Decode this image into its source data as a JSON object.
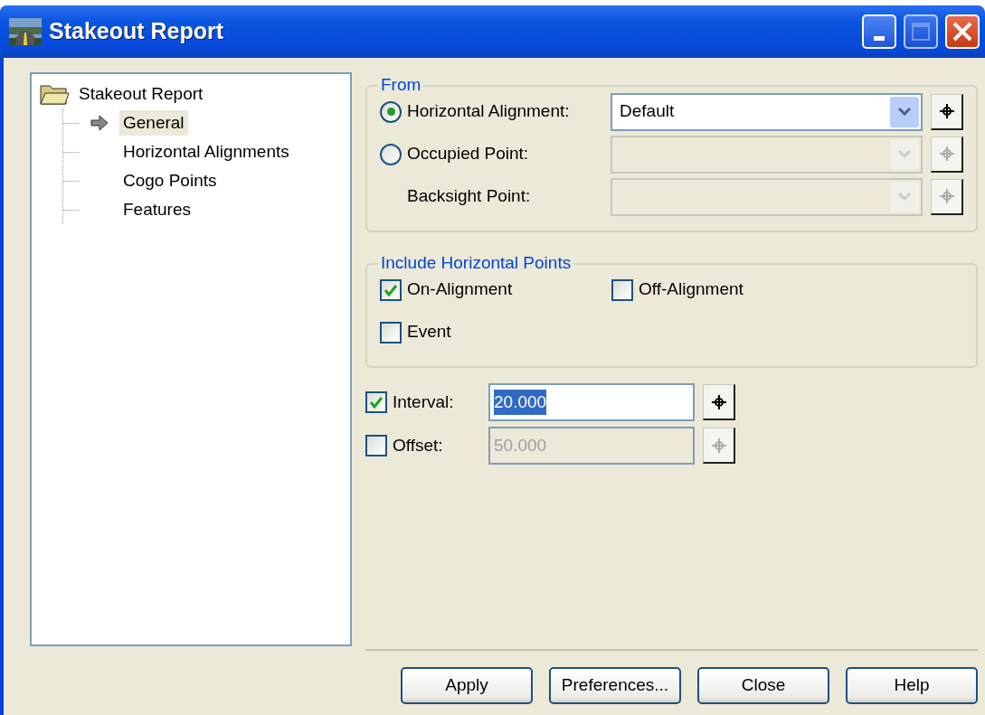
{
  "window": {
    "title": "Stakeout Report"
  },
  "tree": {
    "label": "Stakeout Report",
    "expanded": true,
    "children": [
      {
        "label": "General",
        "selected": true
      },
      {
        "label": "Horizontal Alignments",
        "selected": false
      },
      {
        "label": "Cogo Points",
        "selected": false
      },
      {
        "label": "Features",
        "selected": false
      }
    ]
  },
  "from": {
    "title": "From",
    "rows": [
      {
        "kind": "radio",
        "label": "Horizontal Alignment:",
        "selected": true,
        "value": "Default",
        "disabled": false
      },
      {
        "kind": "radio",
        "label": "Occupied Point:",
        "selected": false,
        "disabled": true
      },
      {
        "kind": "plain",
        "label": "Backsight Point:",
        "disabled": true
      }
    ]
  },
  "include": {
    "title": "Include Horizontal Points",
    "items": [
      {
        "label": "On-Alignment",
        "checked": true
      },
      {
        "label": "Off-Alignment",
        "checked": false
      },
      {
        "label": "Event",
        "checked": false
      }
    ]
  },
  "fields": [
    {
      "label": "Interval:",
      "checked": true,
      "value": "20.000",
      "text_selected": true,
      "disabled": false
    },
    {
      "label": "Offset:",
      "checked": false,
      "value": "50.000",
      "text_selected": false,
      "disabled": true
    }
  ],
  "buttons": [
    "Apply",
    "Preferences...",
    "Close",
    "Help"
  ]
}
